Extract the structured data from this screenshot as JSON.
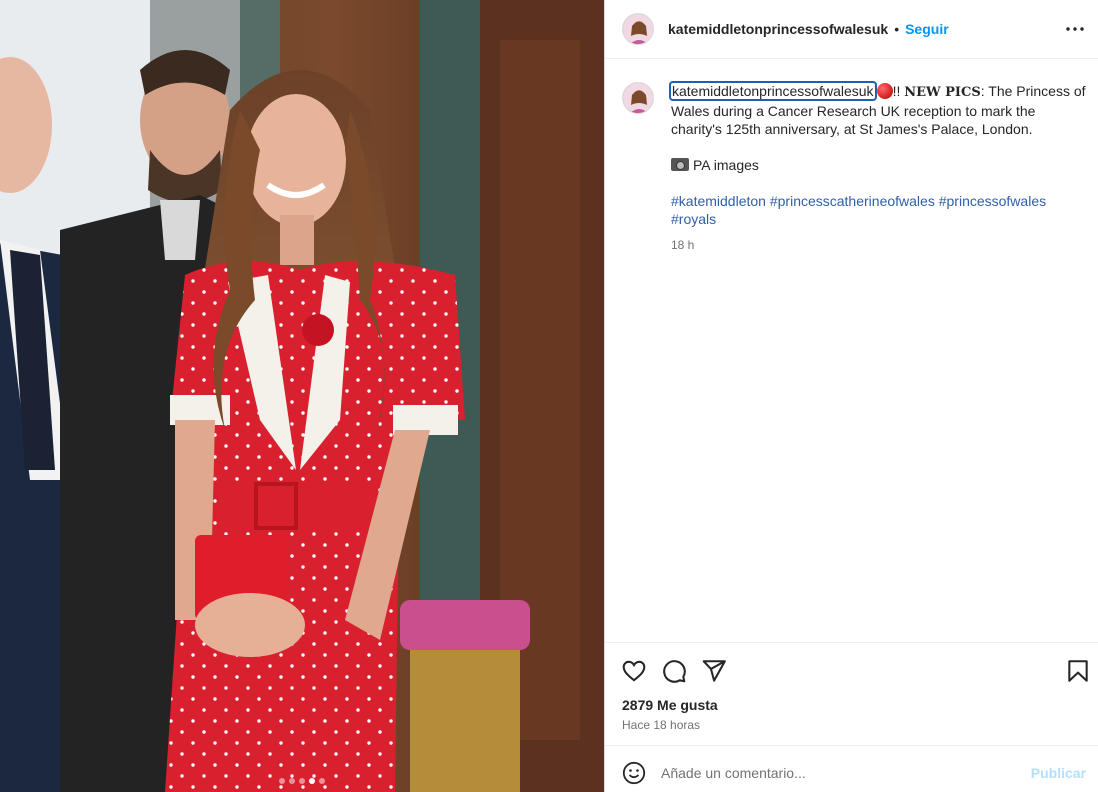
{
  "header": {
    "username": "katemiddletonprincessofwalesuk",
    "separator": "•",
    "follow_label": "Seguir",
    "more_icon": "more-horizontal-icon"
  },
  "caption": {
    "username": "katemiddletonprincessofwalesuk",
    "emoji": "red-circle",
    "exclaim": "!! ",
    "new_pics": "NEW PICS",
    "text": ": The Princess of Wales during a Cancer Research UK reception to mark the charity's 125th anniversary, at St James's Palace, London.",
    "credit_icon": "camera-icon",
    "credit": "PA images",
    "hashtags": [
      "#katemiddleton",
      "#princesscatherineofwales",
      "#princessofwales",
      "#royals"
    ],
    "time": "18 h"
  },
  "actions": {
    "like_icon": "heart-icon",
    "comment_icon": "comment-icon",
    "share_icon": "share-icon",
    "save_icon": "bookmark-icon"
  },
  "stats": {
    "likes": "2879 Me gusta",
    "posted": "Hace 18 horas"
  },
  "comment": {
    "emoji_icon": "smiley-icon",
    "placeholder": "Añade un comentario...",
    "publish_label": "Publicar"
  },
  "carousel": {
    "count": 5,
    "active": 4
  },
  "colors": {
    "accent": "#0095f6",
    "publish_disabled": "#b2dffc",
    "dress_red": "#d8202e"
  }
}
